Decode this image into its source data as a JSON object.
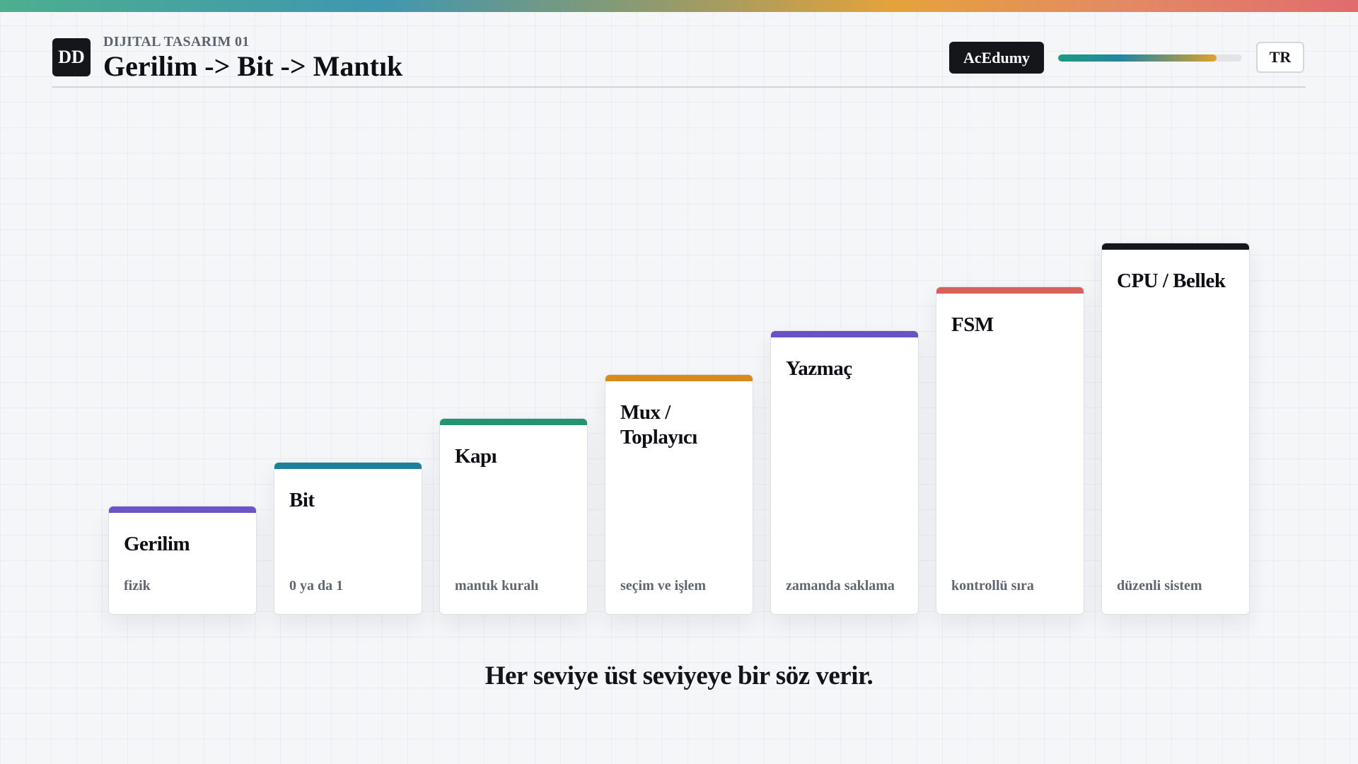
{
  "header": {
    "logo_text": "DD",
    "eyebrow": "DIJITAL TASARIM 01",
    "title": "Gerilim -> Bit -> Mantık",
    "brand": "AcEdumy",
    "progress_fraction": 0.86,
    "language": "TR"
  },
  "colors": {
    "purple": "#6a55c6",
    "teal": "#1f7f9a",
    "green": "#229570",
    "orange": "#d88b1c",
    "violet": "#6753c5",
    "red": "#d8605a",
    "black": "#14161c"
  },
  "steps": [
    {
      "title": "Gerilim",
      "desc": "fizik",
      "accent": "#6a55c6"
    },
    {
      "title": "Bit",
      "desc": "0 ya da 1",
      "accent": "#1f7f9a"
    },
    {
      "title": "Kapı",
      "desc": "mantık kuralı",
      "accent": "#229570"
    },
    {
      "title": "Mux / Toplayıcı",
      "desc": "seçim ve işlem",
      "accent": "#d88b1c"
    },
    {
      "title": "Yazmaç",
      "desc": "zamanda saklama",
      "accent": "#6753c5"
    },
    {
      "title": "FSM",
      "desc": "kontrollü sıra",
      "accent": "#d8605a"
    },
    {
      "title": "CPU / Bellek",
      "desc": "düzenli sistem",
      "accent": "#14161c"
    }
  ],
  "tagline": "Her seviye üst seviyeye bir söz verir."
}
